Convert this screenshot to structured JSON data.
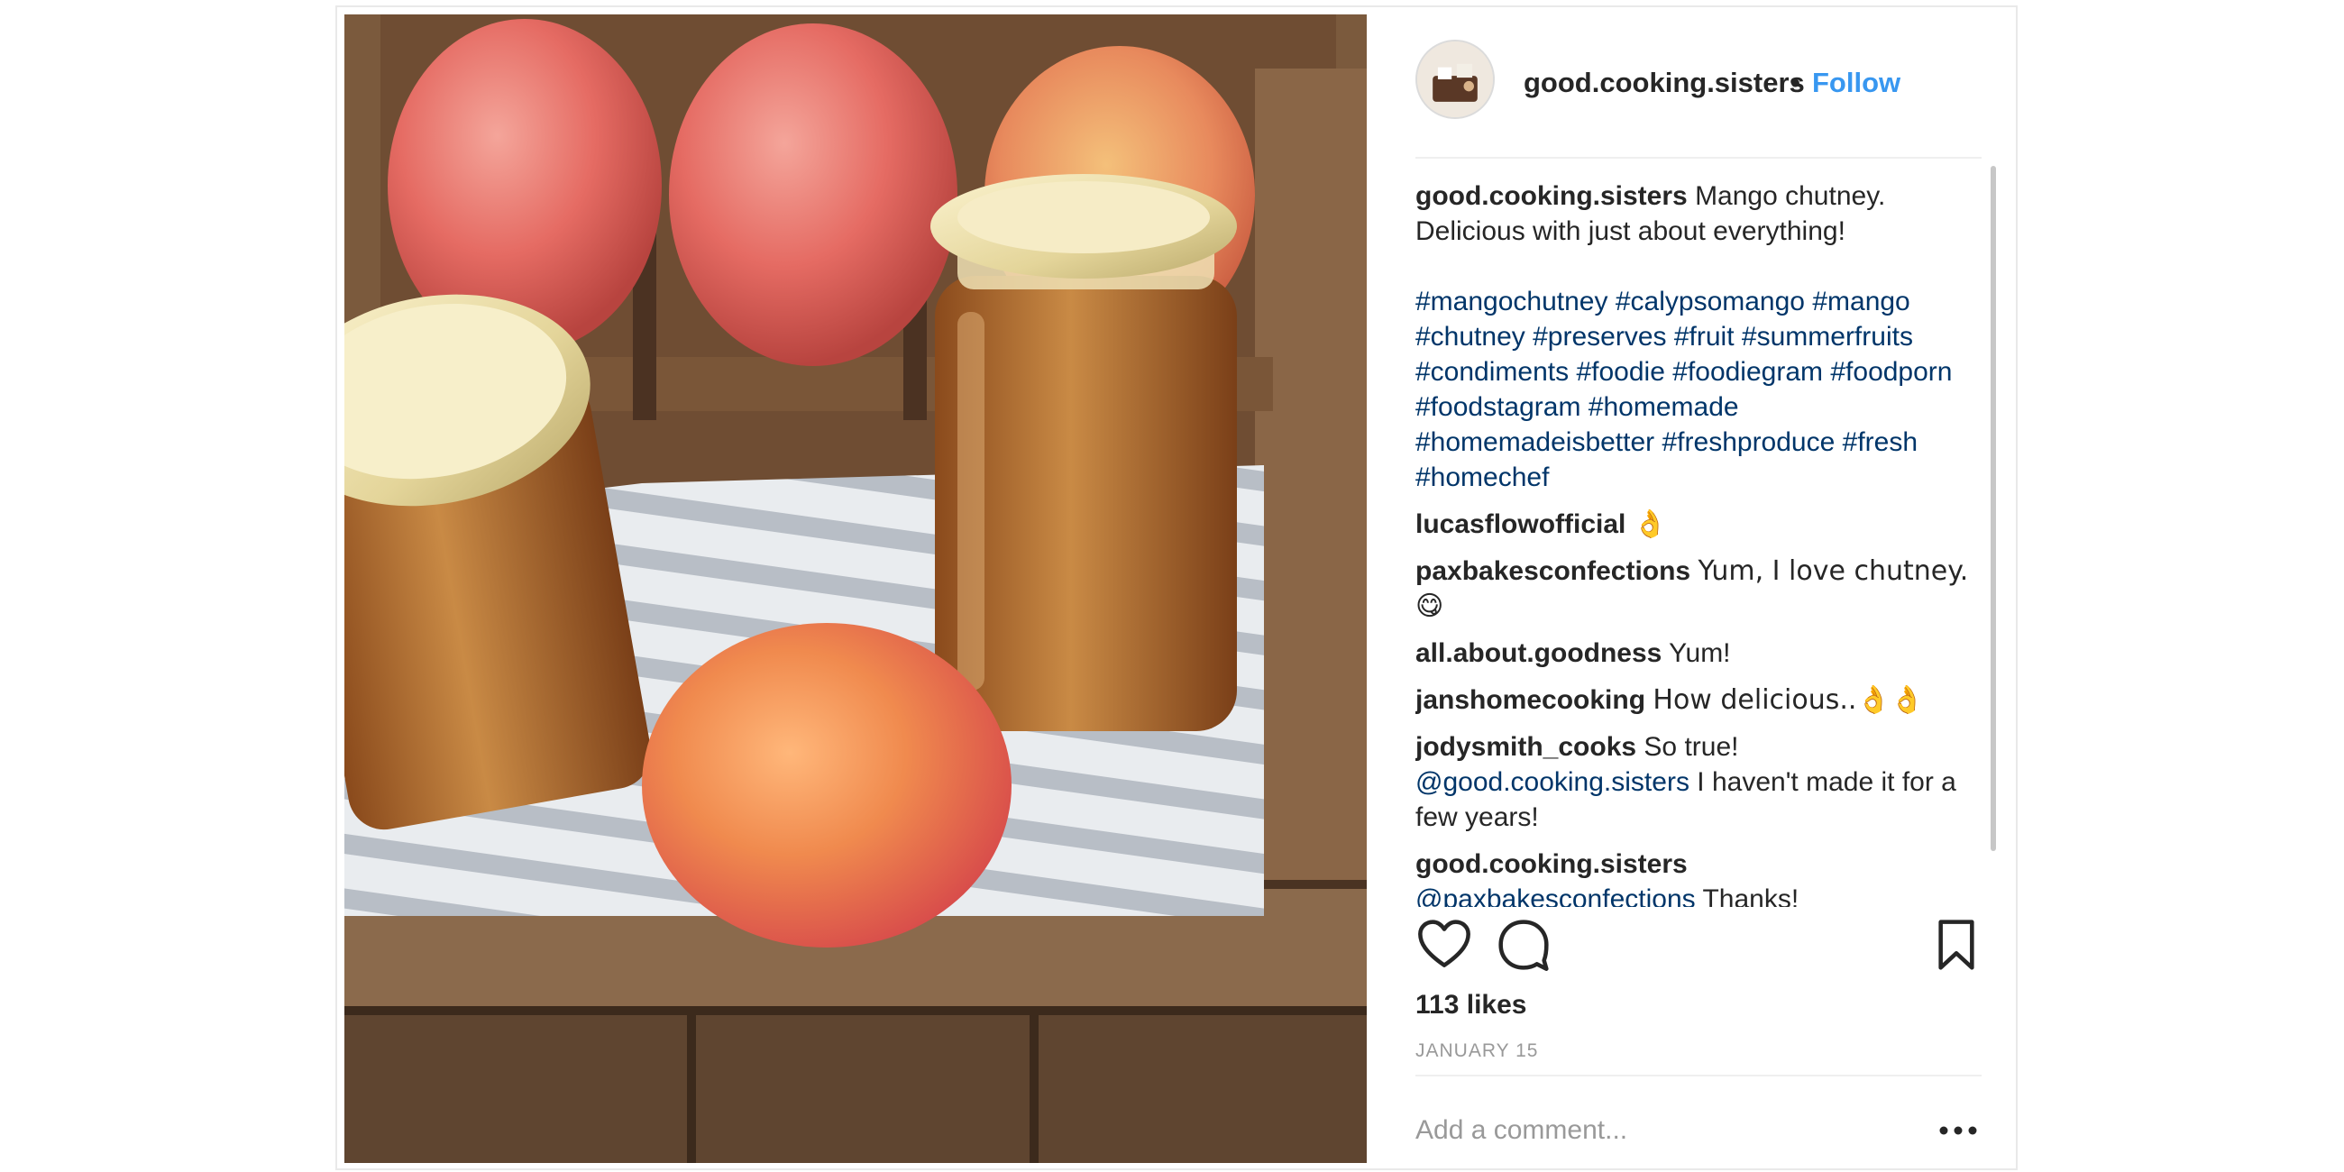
{
  "post": {
    "username": "good.cooking.sisters",
    "separator": "•",
    "follow_label": "Follow",
    "caption_user": "good.cooking.sisters",
    "caption_text": "Mango chutney. Delicious with just about everything!",
    "hashtags": [
      "#mangochutney",
      "#calypsomango",
      "#mango",
      "#chutney",
      "#preserves",
      "#fruit",
      "#summerfruits",
      "#condiments",
      "#foodie",
      "#foodiegram",
      "#foodporn",
      "#foodstagram",
      "#homemade",
      "#homemadeisbetter",
      "#freshproduce",
      "#fresh",
      "#homechef"
    ],
    "likes": "113 likes",
    "date": "JANUARY 15",
    "comment_placeholder": "Add a comment..."
  },
  "comments": [
    {
      "user": "lucasflowofficial",
      "text": "👌"
    },
    {
      "user": "paxbakesconfections",
      "text": "Yum, I love chutney. 😋"
    },
    {
      "user": "all.about.goodness",
      "text": "Yum!"
    },
    {
      "user": "janshomecooking",
      "text": "How delicious..👌👌"
    },
    {
      "user": "jodysmith_cooks",
      "text_before": "So true!",
      "mention": "@good.cooking.sisters",
      "text_after": "I haven't made it for a few years!"
    },
    {
      "user": "good.cooking.sisters",
      "mention": "@paxbakesconfections",
      "text_after": "Thanks!"
    }
  ],
  "icons": {
    "like": "heart-icon",
    "comment": "speech-bubble-icon",
    "save": "bookmark-icon",
    "more": "more-options-icon",
    "avatar": "profile-avatar"
  },
  "colors": {
    "link_blue": "#3897f0",
    "hashtag_blue": "#003569",
    "text": "#262626",
    "muted": "#999999"
  }
}
